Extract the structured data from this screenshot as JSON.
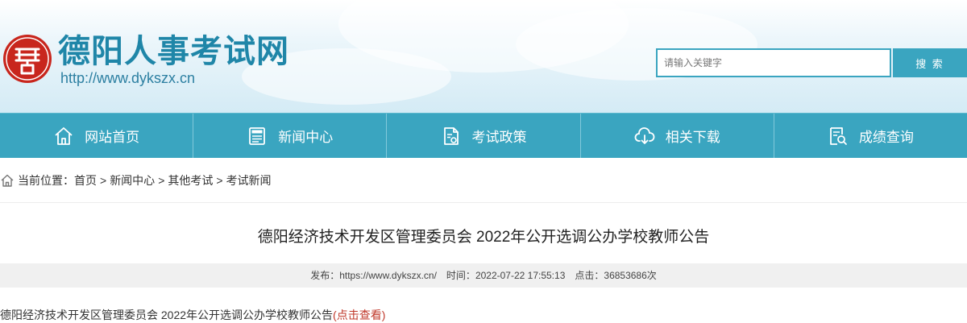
{
  "site": {
    "name": "德阳人事考试网",
    "url": "http://www.dykszx.cn",
    "logo_icon": "seal-logo-icon"
  },
  "search": {
    "placeholder": "请输入关键字",
    "button_label": "搜 索"
  },
  "nav": {
    "items": [
      {
        "label": "网站首页",
        "icon": "home-icon"
      },
      {
        "label": "新闻中心",
        "icon": "news-icon"
      },
      {
        "label": "考试政策",
        "icon": "policy-document-icon"
      },
      {
        "label": "相关下载",
        "icon": "cloud-download-icon"
      },
      {
        "label": "成绩查询",
        "icon": "search-document-icon"
      }
    ]
  },
  "breadcrumb": {
    "prefix": "当前位置：",
    "items": [
      "首页",
      "新闻中心",
      "其他考试",
      "考试新闻"
    ],
    "separator": ">"
  },
  "article": {
    "title": "德阳经济技术开发区管理委员会 2022年公开选调公办学校教师公告",
    "publisher_label": "发布：",
    "publisher": "https://www.dykszx.cn/",
    "time_label": "时间：",
    "time": "2022-07-22 17:55:13",
    "clicks_label": "点击：",
    "clicks": "36853686次",
    "body_text": "德阳经济技术开发区管理委员会 2022年公开选调公办学校教师公告",
    "body_link": "(点击查看)"
  },
  "colors": {
    "accent": "#3aa5c0",
    "brand_text": "#1f86a8",
    "seal_red": "#c8261d",
    "link_red": "#c0392b"
  }
}
